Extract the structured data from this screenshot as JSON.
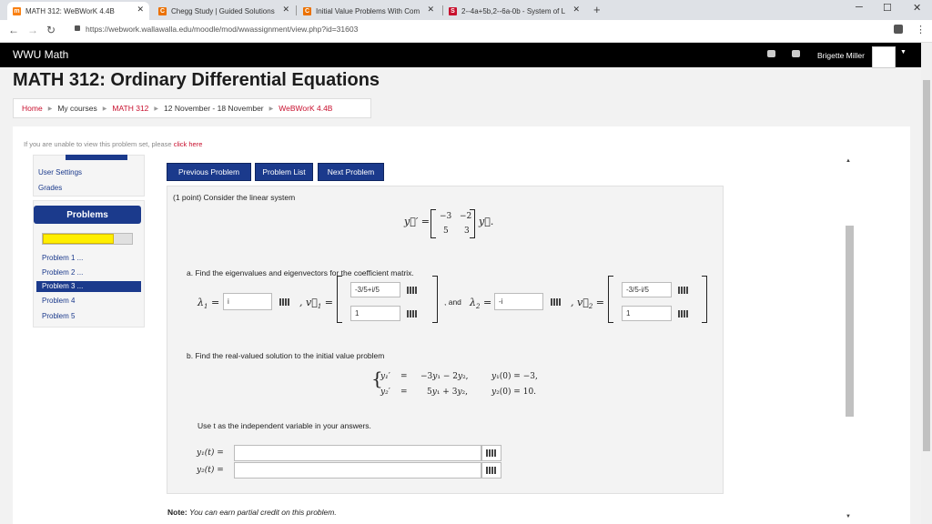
{
  "browser": {
    "tabs": [
      {
        "label": "MATH 312: WeBWorK 4.4B",
        "icon": "moodle-icon"
      },
      {
        "label": "Chegg Study | Guided Solutions",
        "icon": "chegg-icon"
      },
      {
        "label": "Initial Value Problems With Com",
        "icon": "chegg-icon"
      },
      {
        "label": "2--4a+5b,2--6a-0b - System of L",
        "icon": "symbolab-icon"
      }
    ],
    "url": "https://webwork.wallawalla.edu/moodle/mod/wwassignment/view.php?id=31603",
    "new_tab": "+",
    "window_controls": [
      "─",
      "☐",
      "✕"
    ]
  },
  "site": {
    "name": "WWU Math",
    "user": "Brigette Miller"
  },
  "page": {
    "title": "MATH 312: Ordinary Differential Equations",
    "breadcrumbs": [
      "Home",
      "My courses",
      "MATH 312",
      "12 November - 18 November",
      "WeBWorK 4.4B"
    ],
    "unable_text": "If you are unable to view this problem set, please ",
    "unable_link": "click here"
  },
  "sidebar": {
    "settings": [
      "User Settings",
      "Grades"
    ],
    "problems_title": "Problems",
    "progress": 0.8,
    "problem_links": [
      "Problem 1 ...",
      "Problem 2 ...",
      "Problem 3 ...",
      "Problem 4",
      "Problem 5"
    ],
    "current": 2
  },
  "buttons": {
    "prev": "Previous Problem",
    "list": "Problem List",
    "next": "Next Problem"
  },
  "problem": {
    "intro": "(1 point) Consider the linear system",
    "matrix": [
      "−3",
      "−2",
      "5",
      "3"
    ],
    "part_a": "a. Find the eigenvalues and eigenvectors for the coefficient matrix.",
    "lambda1": "i",
    "v1": [
      "-3/5+i/5",
      "1"
    ],
    "and_text": ", and",
    "lambda2": "-i",
    "v2": [
      "-3/5-i/5",
      "1"
    ],
    "part_b": "b. Find the real-valued solution to the initial value problem",
    "use_t": "Use t as the independent variable in your answers.",
    "y1_value": "",
    "y2_value": "",
    "note_label": "Note:",
    "note_text": "You can earn partial credit on this problem."
  }
}
